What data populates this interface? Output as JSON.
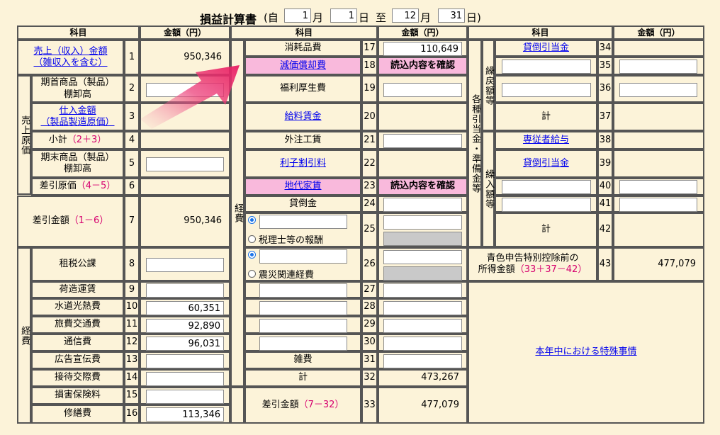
{
  "header": {
    "title": "損益計算書",
    "open_paren": "(自",
    "from_month": "1",
    "month_label_1": "月",
    "from_day": "1",
    "day_label_1": "日",
    "to_label": "至",
    "to_month": "12",
    "month_label_2": "月",
    "to_day": "31",
    "close_label": "日)"
  },
  "col_headers": {
    "item": "科目",
    "amount": "金額（円）"
  },
  "left": {
    "sales_line1": "売上（収入）金額",
    "sales_line2": "（雑収入を含む）",
    "sales_value": "950,346",
    "cogs_group": "売上原価",
    "opening_inv_l1": "期首商品（製品）",
    "opening_inv_l2": "棚卸高",
    "purchases_l1": "仕入金額",
    "purchases_l2": "（製品製造原価）",
    "subtotal": "小計",
    "subtotal_formula": "（2＋3）",
    "closing_inv_l1": "期末商品（製品）",
    "closing_inv_l2": "棚卸高",
    "cogs": "差引原価",
    "cogs_formula": "（4－5）",
    "gross": "差引金額",
    "gross_formula": "（1－6）",
    "gross_value": "950,346",
    "exp_group": "経費",
    "taxes": "租税公課",
    "freight": "荷造運賃",
    "utilities": "水道光熱費",
    "utilities_value": "60,351",
    "travel": "旅費交通費",
    "travel_value": "92,890",
    "comm": "通信費",
    "comm_value": "96,031",
    "ads": "広告宣伝費",
    "entertain": "接待交際費",
    "insurance": "損害保険料",
    "repair": "修繕費",
    "repair_value": "113,346"
  },
  "middle": {
    "exp_group": "経費",
    "supplies": "消耗品費",
    "supplies_value": "110,649",
    "depreciation": "減価償却費",
    "read_confirm": "読込内容を確認",
    "welfare": "福利厚生費",
    "salaries": "給料賃金",
    "outsourcing": "外注工賃",
    "interest": "利子割引料",
    "rent": "地代家賃",
    "bad_debt": "貸倒金",
    "tax_accountant": "税理士等の報酬",
    "disaster": "震災関連経費",
    "misc": "雑費",
    "total": "計",
    "total_value": "473,267",
    "net": "差引金額",
    "net_formula": "（7－32）",
    "net_value": "477,079"
  },
  "right": {
    "provisions_group": "各種引当金・準備金等",
    "reversal_group": "繰戻額等",
    "transfer_group": "繰入額等",
    "bad_debt_reserve": "貸倒引当金",
    "total": "計",
    "family_salary": "専従者給与",
    "pre_deduction_l1": "青色申告特別控除前の",
    "pre_deduction_l2": "所得金額",
    "pre_deduction_formula": "（33＋37－42）",
    "pre_deduction_value": "477,079",
    "special_circumstances": "本年中における特殊事情"
  },
  "line_numbers": [
    "1",
    "2",
    "3",
    "4",
    "5",
    "6",
    "7",
    "8",
    "9",
    "10",
    "11",
    "12",
    "13",
    "14",
    "15",
    "16",
    "17",
    "18",
    "19",
    "20",
    "21",
    "22",
    "23",
    "24",
    "25",
    "26",
    "27",
    "28",
    "29",
    "30",
    "31",
    "32",
    "33",
    "34",
    "35",
    "36",
    "37",
    "38",
    "39",
    "40",
    "41",
    "42",
    "43"
  ],
  "colors": {
    "background": "#fcf3d9",
    "border": "#555555",
    "highlight": "#f9b9dc",
    "link": "#0000ee",
    "formula": "#d6006f",
    "radio": "#1a73e8"
  }
}
